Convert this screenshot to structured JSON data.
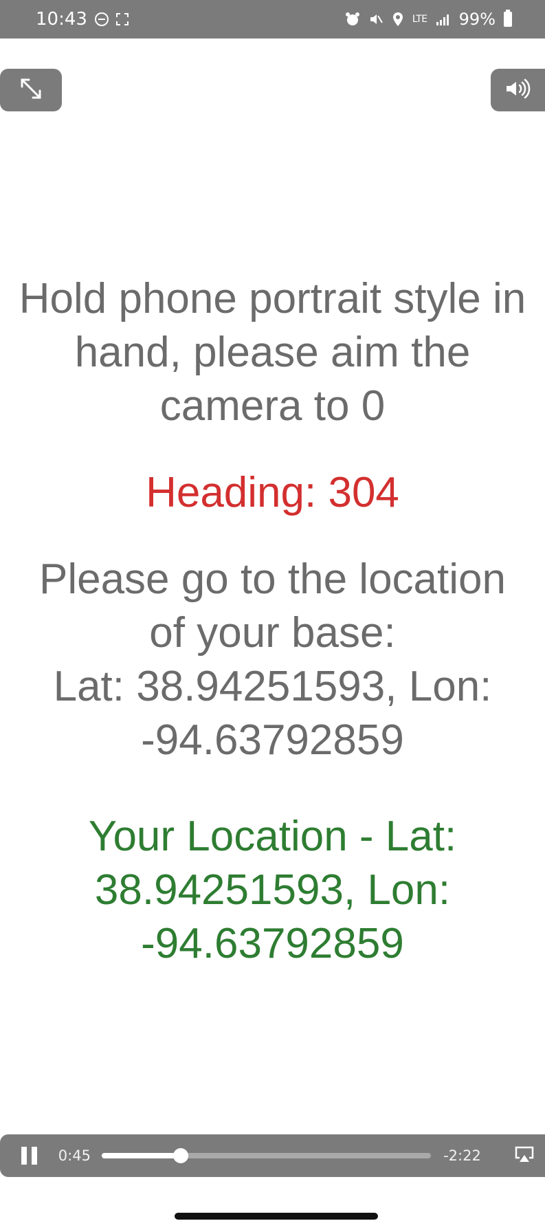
{
  "status_bar": {
    "time": "10:43",
    "battery_percent": "99%",
    "network": "LTE"
  },
  "message": {
    "instruction": "Hold phone portrait style in hand, please aim the camera to 0",
    "heading": "Heading: 304",
    "base_line1": "Please go to the location of your base:",
    "base_line2": "Lat: 38.94251593, Lon: -94.63792859",
    "your_location": "Your Location - Lat: 38.94251593, Lon: -94.63792859"
  },
  "player": {
    "elapsed": "0:45",
    "remaining": "-2:22",
    "progress_fraction": 0.24
  },
  "colors": {
    "heading": "#d32f2f",
    "your_location": "#2e7d32",
    "instruction": "#6b6b6b"
  },
  "icons": {
    "fullscreen": "expand-icon",
    "volume": "speaker-icon",
    "pause": "pause-icon",
    "airplay": "airplay-icon"
  }
}
